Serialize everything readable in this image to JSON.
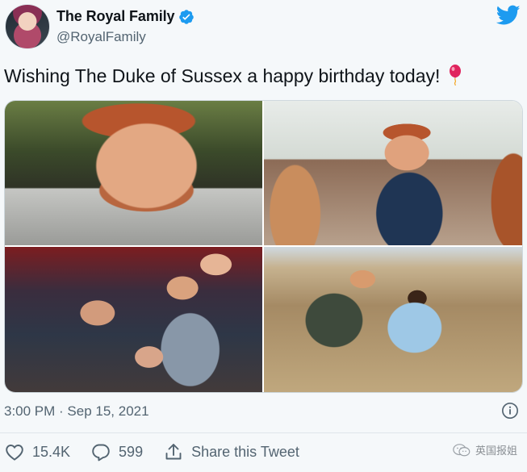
{
  "account": {
    "display_name": "The Royal Family",
    "handle": "@RoyalFamily",
    "verified": true
  },
  "tweet": {
    "text": "Wishing The Duke of Sussex a happy birthday today!",
    "emoji": "balloon-emoji",
    "timestamp": "3:00 PM · Sep 15, 2021",
    "photos": 4
  },
  "actions": {
    "likes": "15.4K",
    "replies": "599",
    "share_label": "Share this Tweet"
  },
  "watermark": {
    "text": "英国报姐"
  },
  "colors": {
    "twitter_blue": "#1d9bf0",
    "muted_text": "#536471",
    "balloon_red": "#e0245e"
  },
  "icons": [
    "twitter-bird-icon",
    "verified-badge-icon",
    "info-icon",
    "heart-icon",
    "reply-icon",
    "share-icon",
    "wechat-icon"
  ]
}
